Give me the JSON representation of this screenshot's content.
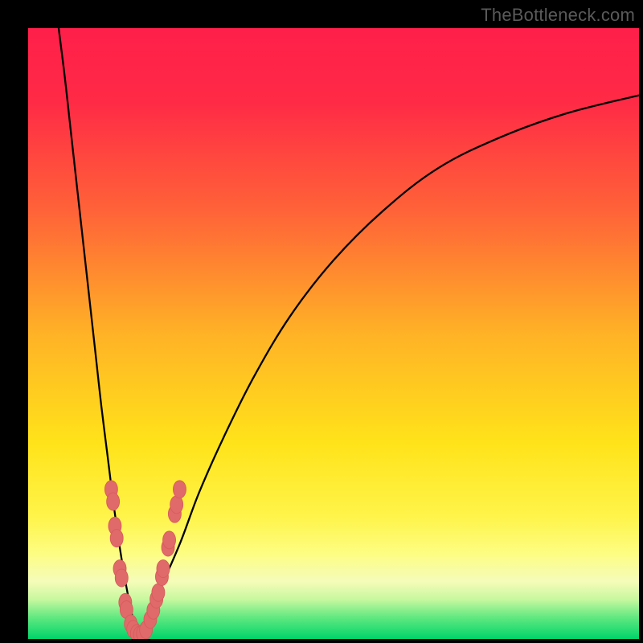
{
  "watermark": "TheBottleneck.com",
  "colors": {
    "gradient_stops": [
      {
        "pos": 0.0,
        "color": "#ff1f4a"
      },
      {
        "pos": 0.12,
        "color": "#ff2a46"
      },
      {
        "pos": 0.3,
        "color": "#ff6338"
      },
      {
        "pos": 0.5,
        "color": "#ffb226"
      },
      {
        "pos": 0.68,
        "color": "#ffe31a"
      },
      {
        "pos": 0.8,
        "color": "#fff44a"
      },
      {
        "pos": 0.86,
        "color": "#fdfd82"
      },
      {
        "pos": 0.905,
        "color": "#f5fcb8"
      },
      {
        "pos": 0.935,
        "color": "#c8f8a0"
      },
      {
        "pos": 0.965,
        "color": "#60e880"
      },
      {
        "pos": 1.0,
        "color": "#00d46a"
      }
    ],
    "curve_stroke": "#000000",
    "marker_fill": "#e06a6a",
    "marker_stroke": "#d85b5b"
  },
  "chart_data": {
    "type": "line",
    "title": "",
    "xlabel": "",
    "ylabel": "",
    "xlim": [
      0,
      100
    ],
    "ylim": [
      0,
      100
    ],
    "x_optimum": 18,
    "series": [
      {
        "name": "left-curve",
        "x": [
          5,
          6,
          7,
          8,
          9,
          10,
          11,
          12,
          13,
          14,
          15,
          16,
          17,
          18
        ],
        "y": [
          100,
          92,
          83,
          74,
          65,
          56,
          47,
          38,
          30,
          22,
          15,
          9,
          4,
          0
        ]
      },
      {
        "name": "right-curve",
        "x": [
          18,
          20,
          22,
          25,
          28,
          32,
          37,
          43,
          50,
          58,
          67,
          77,
          88,
          100
        ],
        "y": [
          0,
          4,
          9,
          16,
          24,
          33,
          43,
          53,
          62,
          70,
          77,
          82,
          86,
          89
        ]
      }
    ],
    "markers": {
      "name": "measured-points",
      "points": [
        {
          "x": 13.6,
          "y": 24.5
        },
        {
          "x": 13.9,
          "y": 22.5
        },
        {
          "x": 14.2,
          "y": 18.5
        },
        {
          "x": 14.5,
          "y": 16.5
        },
        {
          "x": 15.0,
          "y": 11.5
        },
        {
          "x": 15.3,
          "y": 10.0
        },
        {
          "x": 15.9,
          "y": 6.0
        },
        {
          "x": 16.1,
          "y": 4.8
        },
        {
          "x": 16.8,
          "y": 2.5
        },
        {
          "x": 17.2,
          "y": 1.6
        },
        {
          "x": 17.8,
          "y": 0.9
        },
        {
          "x": 18.3,
          "y": 0.7
        },
        {
          "x": 18.8,
          "y": 0.9
        },
        {
          "x": 19.3,
          "y": 1.5
        },
        {
          "x": 20.0,
          "y": 3.2
        },
        {
          "x": 20.5,
          "y": 4.7
        },
        {
          "x": 21.0,
          "y": 6.5
        },
        {
          "x": 21.3,
          "y": 7.6
        },
        {
          "x": 21.9,
          "y": 10.2
        },
        {
          "x": 22.1,
          "y": 11.5
        },
        {
          "x": 22.9,
          "y": 15.0
        },
        {
          "x": 23.1,
          "y": 16.2
        },
        {
          "x": 24.0,
          "y": 20.5
        },
        {
          "x": 24.3,
          "y": 22.0
        },
        {
          "x": 24.8,
          "y": 24.5
        }
      ]
    }
  }
}
